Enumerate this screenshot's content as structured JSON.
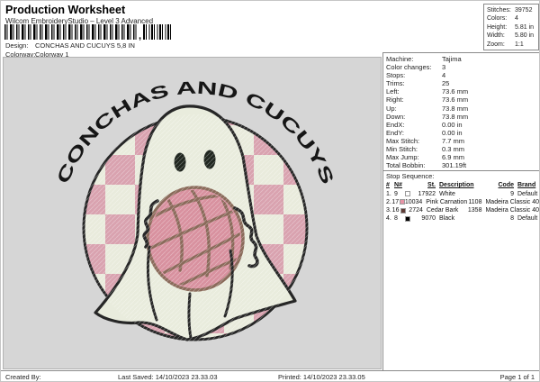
{
  "header": {
    "title": "Production Worksheet",
    "subtitle": "Wilcom EmbroideryStudio – Level 3 Advanced",
    "barcode_comma": ",",
    "design_label": "Design:",
    "design_value": "CONCHAS AND CUCUYS 5,8 IN",
    "colorway_label": "Colorway:",
    "colorway_value": "Colorway 1"
  },
  "summary_box": {
    "rows": [
      {
        "label": "Stitches:",
        "value": "39752"
      },
      {
        "label": "Colors:",
        "value": "4"
      },
      {
        "label": "Height:",
        "value": "5.81 in"
      },
      {
        "label": "Width:",
        "value": "5.80 in"
      },
      {
        "label": "Zoom:",
        "value": "1:1"
      }
    ]
  },
  "machine_info": {
    "rows": [
      {
        "label": "Machine:",
        "value": "Tajima"
      },
      {
        "label": "Color changes:",
        "value": "3"
      },
      {
        "label": "Stops:",
        "value": "4"
      },
      {
        "label": "Trims:",
        "value": "25"
      },
      {
        "label": "Left:",
        "value": "73.6 mm"
      },
      {
        "label": "Right:",
        "value": "73.6 mm"
      },
      {
        "label": "Up:",
        "value": "73.8 mm"
      },
      {
        "label": "Down:",
        "value": "73.8 mm"
      },
      {
        "label": "EndX:",
        "value": "0.00 in"
      },
      {
        "label": "EndY:",
        "value": "0.00 in"
      },
      {
        "label": "Max Stitch:",
        "value": "7.7 mm"
      },
      {
        "label": "Min Stitch:",
        "value": "0.3 mm"
      },
      {
        "label": "Max Jump:",
        "value": "6.9 mm"
      },
      {
        "label": "Total Bobbin:",
        "value": "301.19ft"
      }
    ]
  },
  "stop_sequence": {
    "title": "Stop Sequence:",
    "headers": {
      "num": "#",
      "n": "N#",
      "st": "St.",
      "description": "Description",
      "code": "Code",
      "brand": "Brand"
    },
    "rows": [
      {
        "num": "1.",
        "n": "9",
        "swatch": "#ffffff",
        "st": "17922",
        "description": "White",
        "code": "9",
        "brand": "Default"
      },
      {
        "num": "2.",
        "n": "17",
        "swatch": "#e794a6",
        "st": "10034",
        "description": "Pink Carnation",
        "code": "1108",
        "brand": "Madeira Classic 40"
      },
      {
        "num": "3.",
        "n": "16",
        "swatch": "#5f3c36",
        "st": "2724",
        "description": "Cedar Bark",
        "code": "1358",
        "brand": "Madeira Classic 40"
      },
      {
        "num": "4.",
        "n": "8",
        "swatch": "#000000",
        "st": "9070",
        "description": "Black",
        "code": "8",
        "brand": "Default"
      }
    ]
  },
  "design_preview": {
    "arc_text": "CONCHAS AND CUCUYS",
    "colors": {
      "background": "#d6d6d6",
      "checker_pink": "#d9a2af",
      "checker_cream": "#e9ebdc",
      "ghost_body": "#e9ecdd",
      "outline_black": "#262626",
      "concha_pink": "#d8919f",
      "concha_outline": "#8a6a5a",
      "eye_black": "#20261f"
    }
  },
  "footer": {
    "created_by": "Created By:",
    "last_saved": "Last Saved: 14/10/2023 23.33.03",
    "printed": "Printed: 14/10/2023 23.33.05",
    "page": "Page 1 of 1"
  }
}
